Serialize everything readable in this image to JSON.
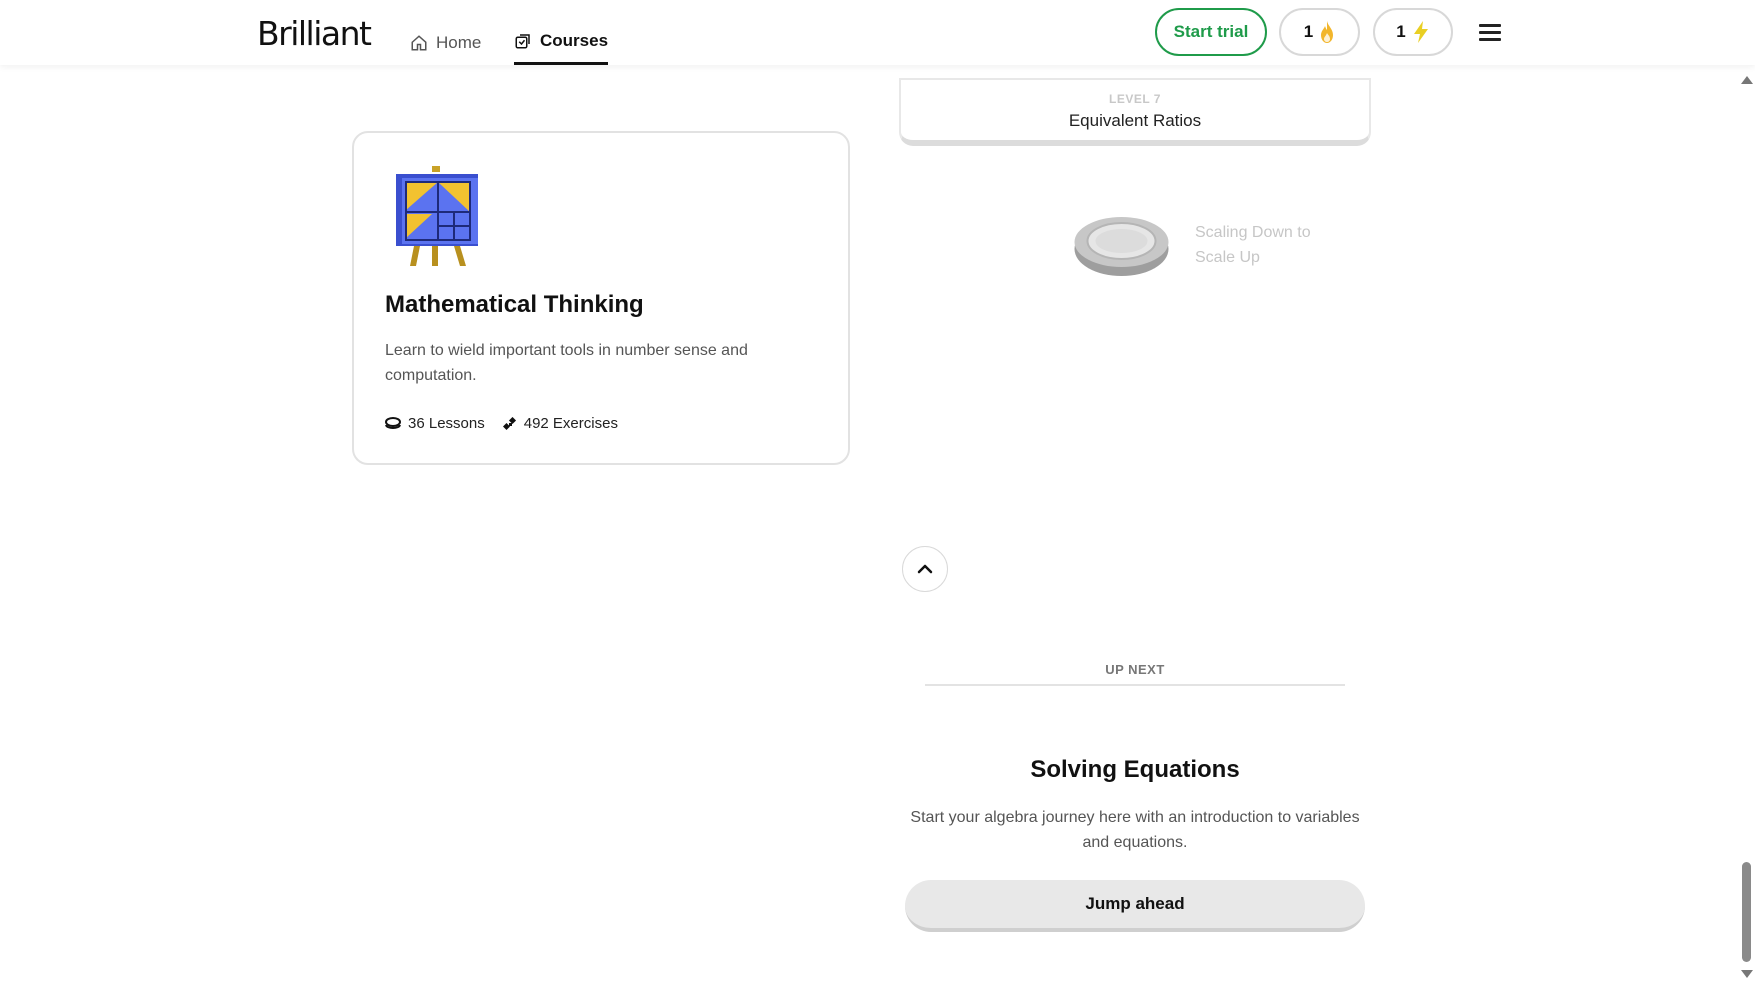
{
  "nav": {
    "logo": "Brilliant",
    "home_label": "Home",
    "courses_label": "Courses",
    "start_trial_label": "Start trial",
    "streak_count": "1",
    "energy_count": "1",
    "accent_color": "#1f9b4a"
  },
  "course_card": {
    "title": "Mathematical Thinking",
    "description": "Learn to wield important tools in number sense and computation.",
    "lessons": "36 Lessons",
    "exercises": "492 Exercises"
  },
  "path": {
    "level_label": "LEVEL 7",
    "level_title": "Equivalent Ratios",
    "lesson_line1": "Scaling Down to",
    "lesson_line2": "Scale Up"
  },
  "up_next": {
    "label": "UP NEXT",
    "title": "Solving Equations",
    "description": "Start your algebra journey here with an introduction to variables and equations.",
    "button_label": "Jump ahead"
  }
}
